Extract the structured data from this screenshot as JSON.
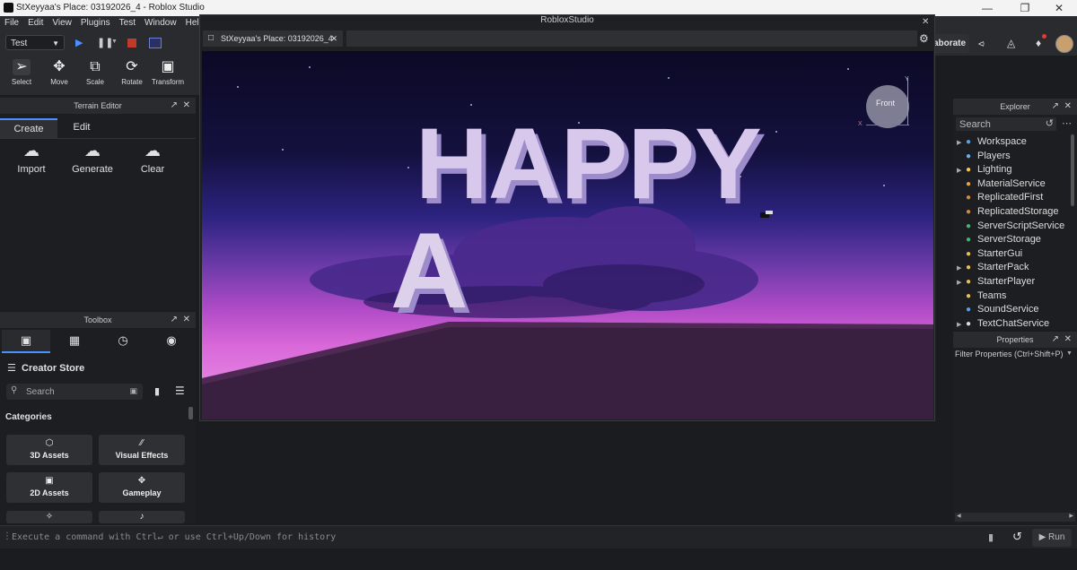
{
  "window": {
    "title": "StXeyyaa's Place: 03192026_4 - Roblox Studio"
  },
  "menu": [
    "File",
    "Edit",
    "View",
    "Plugins",
    "Test",
    "Window",
    "Hel"
  ],
  "toolbar": {
    "mode": "Test",
    "tools": [
      "Select",
      "Move",
      "Scale",
      "Rotate",
      "Transform"
    ],
    "collaborate": "aborate"
  },
  "terrain_editor": {
    "title": "Terrain Editor",
    "tabs": [
      "Create",
      "Edit"
    ],
    "buttons": [
      "Import",
      "Generate",
      "Clear"
    ]
  },
  "toolbox": {
    "title": "Toolbox",
    "store": "Creator Store",
    "search_placeholder": "Search",
    "categories_label": "Categories",
    "categories": [
      "3D Assets",
      "Visual Effects",
      "2D Assets",
      "Gameplay"
    ]
  },
  "viewport": {
    "window_title": "RobloxStudio",
    "tab": "StXeyyaa's Place: 03192026_4",
    "gizmo_label": "Front",
    "gizmo_axes": [
      "X",
      "Y"
    ],
    "scene_text": [
      "HAPPY",
      "A"
    ]
  },
  "explorer": {
    "title": "Explorer",
    "search_placeholder": "Search",
    "items": [
      {
        "label": "Workspace",
        "expandable": true,
        "icon": "globe-icon",
        "color": "#5aa0e8"
      },
      {
        "label": "Players",
        "expandable": false,
        "icon": "players-icon",
        "color": "#66b0f0"
      },
      {
        "label": "Lighting",
        "expandable": true,
        "icon": "lightbulb-icon",
        "color": "#f2c94c"
      },
      {
        "label": "MaterialService",
        "expandable": false,
        "icon": "material-icon",
        "color": "#e8a040"
      },
      {
        "label": "ReplicatedFirst",
        "expandable": false,
        "icon": "replicated-icon",
        "color": "#d08a3a"
      },
      {
        "label": "ReplicatedStorage",
        "expandable": false,
        "icon": "storage-icon",
        "color": "#d08a3a"
      },
      {
        "label": "ServerScriptService",
        "expandable": false,
        "icon": "script-service-icon",
        "color": "#3fb86a"
      },
      {
        "label": "ServerStorage",
        "expandable": false,
        "icon": "server-storage-icon",
        "color": "#3fb86a"
      },
      {
        "label": "StarterGui",
        "expandable": false,
        "icon": "gui-icon",
        "color": "#e8c050"
      },
      {
        "label": "StarterPack",
        "expandable": true,
        "icon": "pack-icon",
        "color": "#e8c050"
      },
      {
        "label": "StarterPlayer",
        "expandable": true,
        "icon": "player-folder-icon",
        "color": "#e8c050"
      },
      {
        "label": "Teams",
        "expandable": false,
        "icon": "teams-icon",
        "color": "#e8c050"
      },
      {
        "label": "SoundService",
        "expandable": false,
        "icon": "sound-icon",
        "color": "#5aa0e8"
      },
      {
        "label": "TextChatService",
        "expandable": true,
        "icon": "chat-icon",
        "color": "#ddd"
      }
    ]
  },
  "properties": {
    "title": "Properties",
    "filter_placeholder": "Filter Properties (Ctrl+Shift+P)"
  },
  "command_bar": {
    "placeholder": "Execute a command with Ctrl↵ or use Ctrl+Up/Down for history",
    "run_label": "Run"
  }
}
